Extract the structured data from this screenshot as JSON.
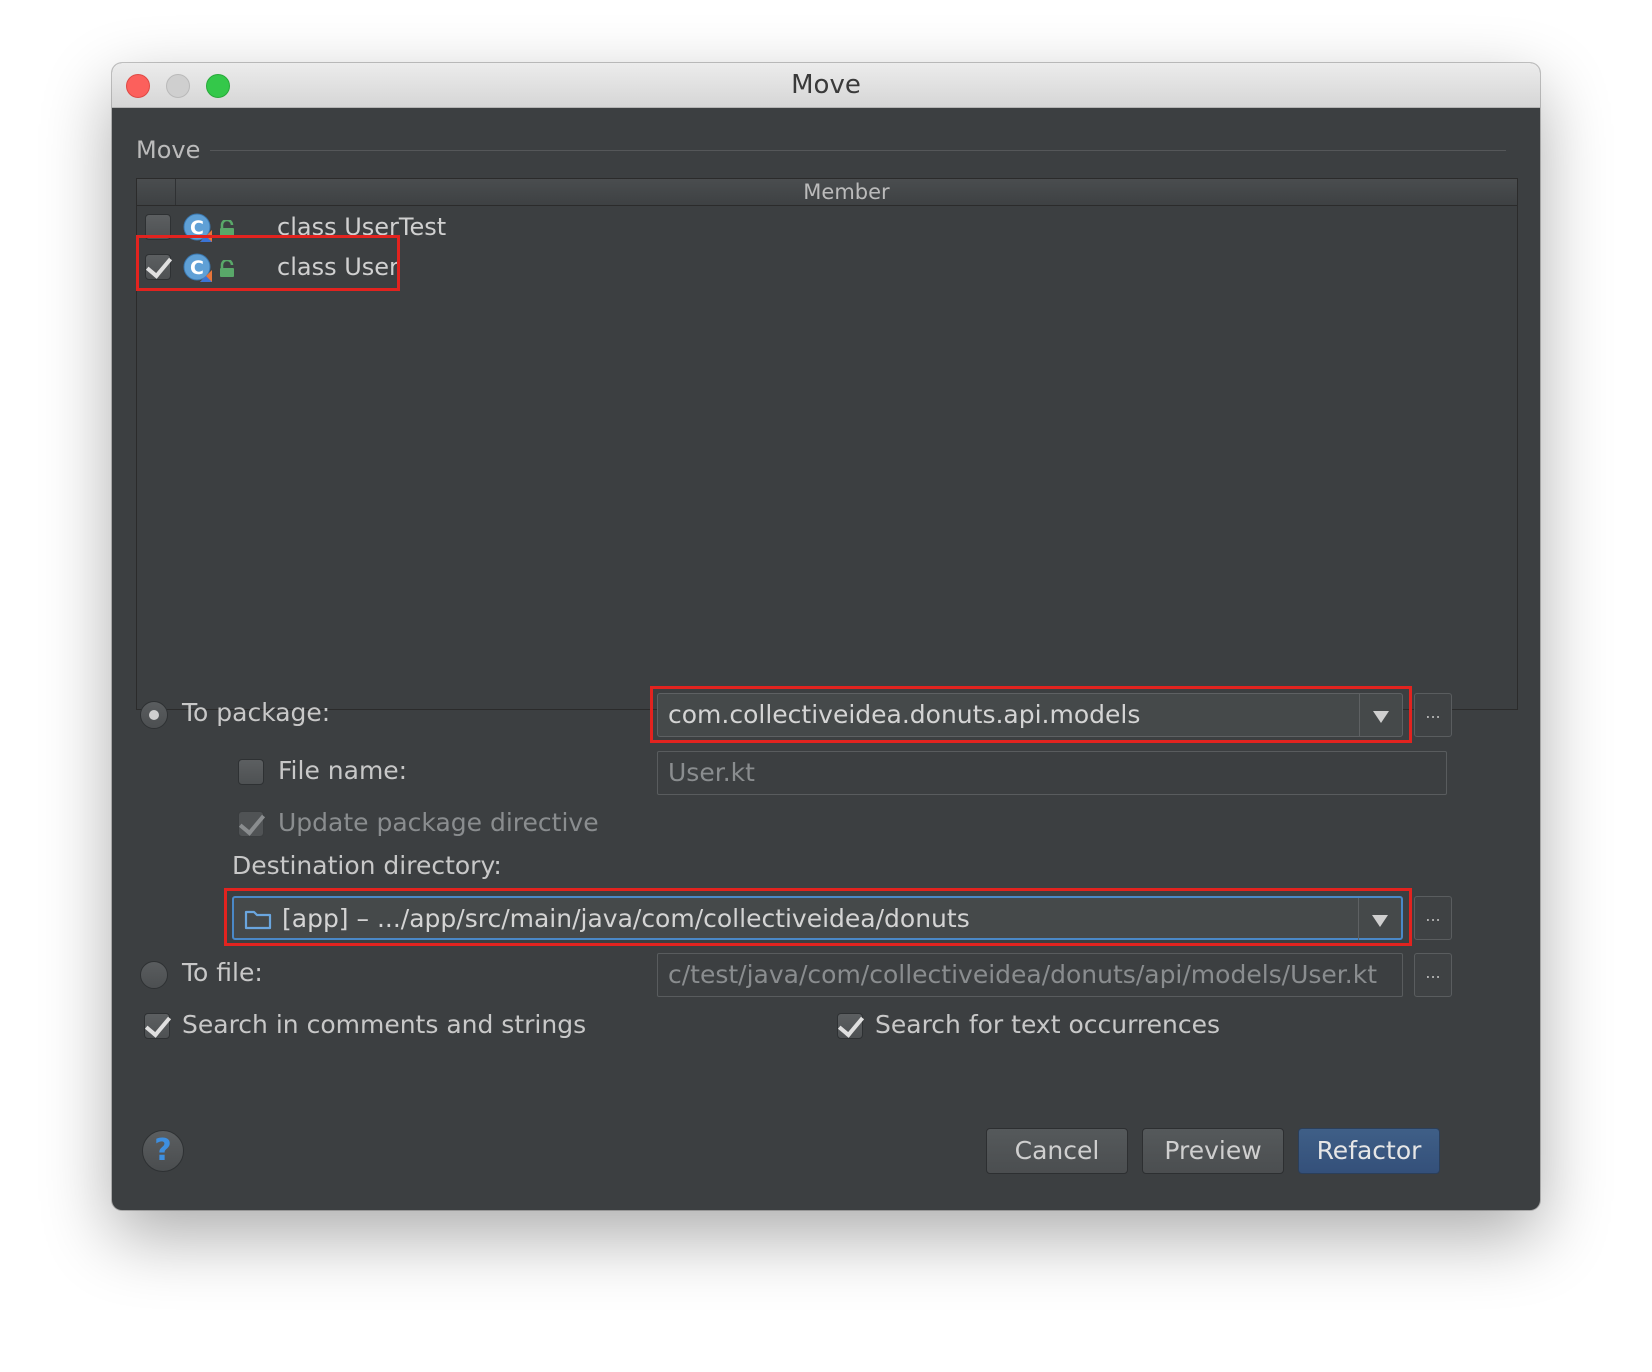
{
  "window": {
    "title": "Move"
  },
  "group": {
    "title": "Move"
  },
  "table": {
    "header": {
      "member": "Member"
    },
    "rows": [
      {
        "label": "class UserTest",
        "checked": false
      },
      {
        "label": "class User",
        "checked": true
      }
    ]
  },
  "to_package": {
    "label": "To package:",
    "value": "com.collectiveidea.donuts.api.models",
    "selected": true
  },
  "file_name": {
    "label": "File name:",
    "value": "User.kt",
    "checked": false
  },
  "update_package": {
    "label": "Update package directive",
    "checked": true
  },
  "destination": {
    "label": "Destination directory:",
    "value": "[app] – .../app/src/main/java/com/collectiveidea/donuts"
  },
  "to_file": {
    "label": "To file:",
    "value": "c/test/java/com/collectiveidea/donuts/api/models/User.kt",
    "selected": false
  },
  "browse_label": "...",
  "options": {
    "search_comments": {
      "label": "Search in comments and strings",
      "checked": true
    },
    "search_text": {
      "label": "Search for text occurrences",
      "checked": true
    }
  },
  "buttons": {
    "help": "?",
    "cancel": "Cancel",
    "preview": "Preview",
    "refactor": "Refactor"
  },
  "colors": {
    "background": "#3c3f41",
    "highlight": "#e2231f",
    "focus": "#4a88c7",
    "default_button": "#365880"
  }
}
